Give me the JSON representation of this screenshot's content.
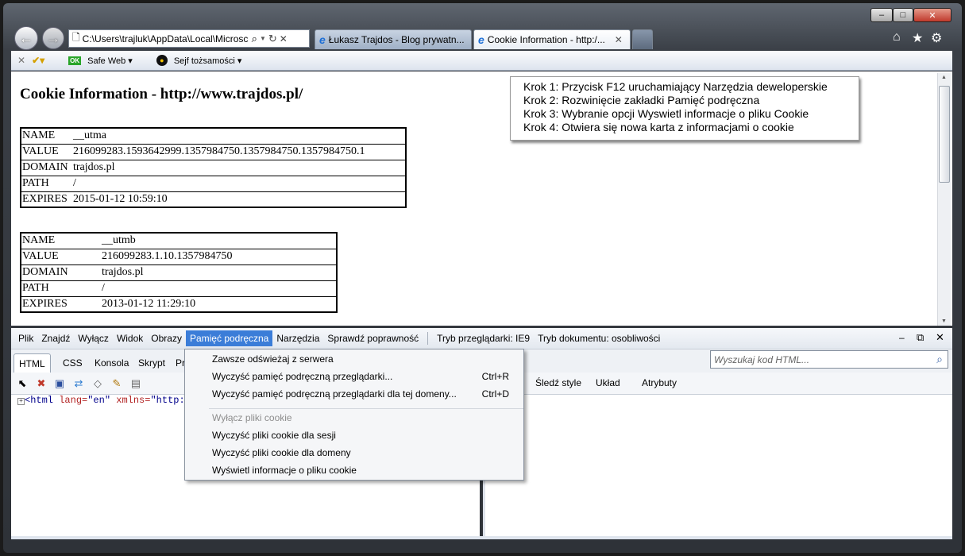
{
  "window": {
    "address": "C:\\Users\\trajluk\\AppData\\Local\\Microsc",
    "tabs": [
      {
        "title": "Łukasz Trajdos - Blog prywatn..."
      },
      {
        "title": "Cookie Information - http:/..."
      }
    ],
    "controls": {
      "minimize": "‒",
      "maximize": "□",
      "close": "✕"
    }
  },
  "command_bar": {
    "safe_web": "Safe Web",
    "sejf": "Sejf tożsamości"
  },
  "page": {
    "title": "Cookie Information - http://www.trajdos.pl/",
    "cookie1": [
      {
        "k": "NAME",
        "v": "__utma"
      },
      {
        "k": "VALUE",
        "v": "216099283.1593642999.1357984750.1357984750.1357984750.1"
      },
      {
        "k": "DOMAIN",
        "v": "trajdos.pl"
      },
      {
        "k": "PATH",
        "v": "/"
      },
      {
        "k": "EXPIRES",
        "v": "2015-01-12 10:59:10"
      }
    ],
    "cookie2": [
      {
        "k": "NAME",
        "v": "__utmb"
      },
      {
        "k": "VALUE",
        "v": "216099283.1.10.1357984750"
      },
      {
        "k": "DOMAIN",
        "v": "trajdos.pl"
      },
      {
        "k": "PATH",
        "v": "/"
      },
      {
        "k": "EXPIRES",
        "v": "2013-01-12 11:29:10"
      }
    ],
    "steps": [
      "Krok 1: Przycisk F12 uruchamiający Narzędzia deweloperskie",
      "Krok 2: Rozwinięcie zakładki Pamięć podręczna",
      "Krok 3: Wybranie opcji Wyswietl informacje o pliku Cookie",
      "Krok 4: Otwiera się nowa karta z informacjami o cookie"
    ]
  },
  "devtools": {
    "menu": {
      "plik": "Plik",
      "znajdz": "Znajdź",
      "wylacz": "Wyłącz",
      "widok": "Widok",
      "obrazy": "Obrazy",
      "pamiec": "Pamięć podręczna",
      "narzedzia": "Narzędzia",
      "sprawdz": "Sprawdź poprawność",
      "tryb_przegladarki": "Tryb przeglądarki: IE9",
      "tryb_dokumentu": "Tryb dokumentu: osobliwości"
    },
    "tabs": {
      "html": "HTML",
      "css": "CSS",
      "konsola": "Konsola",
      "skrypt": "Skrypt",
      "pr": "Pr"
    },
    "search_placeholder": "Wyszukaj kod HTML...",
    "right_tabs": {
      "sledz": "Śledź style",
      "uklad": "Układ",
      "atrybuty": "Atrybuty"
    },
    "code": {
      "tag": "<html",
      "attr1": "lang=",
      "val1": "\"en\"",
      "attr2": "xmlns=",
      "val2": "\"http:"
    }
  },
  "dropdown": {
    "items": [
      {
        "label": "Zawsze odświeżaj z serwera",
        "shortcut": ""
      },
      {
        "label": "Wyczyść pamięć podręczną przeglądarki...",
        "shortcut": "Ctrl+R"
      },
      {
        "label": "Wyczyść pamięć podręczną przeglądarki dla tej domeny...",
        "shortcut": "Ctrl+D"
      },
      {
        "label": "Wyłącz pliki cookie",
        "shortcut": ""
      },
      {
        "label": "Wyczyść pliki cookie dla sesji",
        "shortcut": ""
      },
      {
        "label": "Wyczyść pliki cookie dla domeny",
        "shortcut": ""
      },
      {
        "label": "Wyświetl informacje o pliku cookie",
        "shortcut": ""
      }
    ]
  }
}
